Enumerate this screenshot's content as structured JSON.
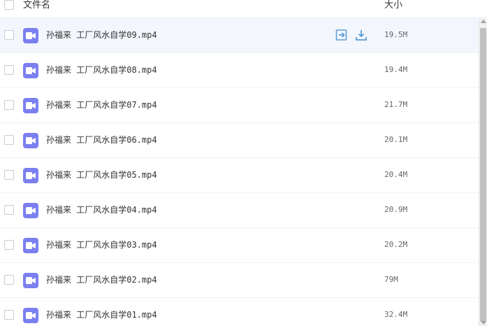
{
  "header": {
    "name_label": "文件名",
    "size_label": "大小"
  },
  "icons": {
    "file": "video-file-icon",
    "share": "share-icon",
    "download": "download-icon",
    "file_color": "#7b7ff0",
    "action_color": "#5b9bd5"
  },
  "rows": [
    {
      "name": "孙福来 工厂风水自学09.mp4",
      "size": "19.5M"
    },
    {
      "name": "孙福来 工厂风水自学08.mp4",
      "size": "19.4M"
    },
    {
      "name": "孙福来 工厂风水自学07.mp4",
      "size": "21.7M"
    },
    {
      "name": "孙福来 工厂风水自学06.mp4",
      "size": "20.1M"
    },
    {
      "name": "孙福来 工厂风水自学05.mp4",
      "size": "20.4M"
    },
    {
      "name": "孙福来 工厂风水自学04.mp4",
      "size": "20.9M"
    },
    {
      "name": "孙福来 工厂风水自学03.mp4",
      "size": "20.2M"
    },
    {
      "name": "孙福来 工厂风水自学02.mp4",
      "size": "79M"
    },
    {
      "name": "孙福来 工厂风水自学01.mp4",
      "size": "32.4M"
    }
  ]
}
